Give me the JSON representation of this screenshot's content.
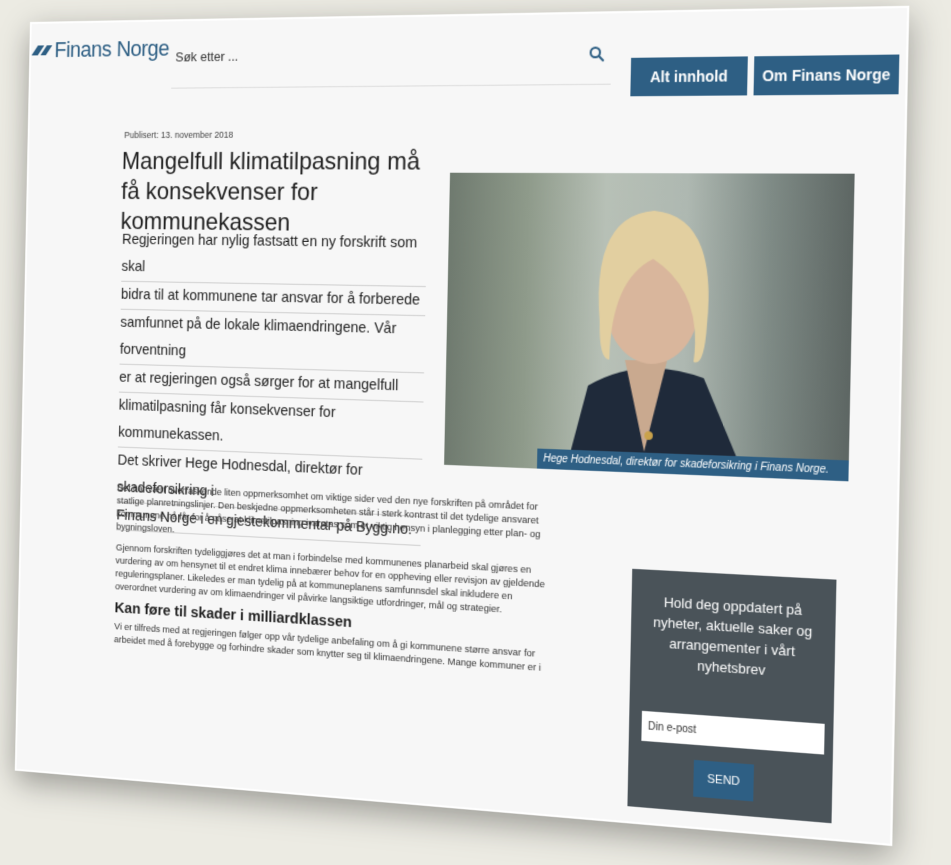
{
  "header": {
    "logo_text": "Finans Norge",
    "search_placeholder": "Søk etter ...",
    "nav": [
      "Alt innhold",
      "Om Finans Norge"
    ]
  },
  "article": {
    "published": "Publisert: 13. november 2018",
    "title": "Mangelfull klimatilpasning må få konsekvenser for kommunekassen",
    "lead_lines": [
      "Regjeringen har nylig fastsatt en ny forskrift som skal",
      "bidra til at kommunene tar ansvar for å forberede",
      "samfunnet på de lokale klimaendringene. Vår forventning",
      "er at regjeringen også sørger for at mangelfull",
      "klimatilpasning får konsekvenser for kommunekassen.",
      "Det skriver Hege Hodnesdal, direktør for skadeforsikring i",
      "Finans Norge i en gjestekommentar på Bygg.no."
    ],
    "photo_caption": "Hege Hodnesdal, direktør for skadeforsikring i Finans Norge.",
    "paragraphs": [
      "Det har vært overraskende liten oppmerksomhet om viktige sider ved den nye forskriften på området for statlige planretningslinjer. Den beskjedne oppmerksomheten står i sterk kontrast til det tydelige ansvaret kommunene nå får for å påse at klimatilpasning ivaretas som et viktig hensyn i planlegging etter plan- og bygningsloven.",
      "Gjennom forskriften tydeliggjøres det at man i forbindelse med kommunenes planarbeid skal gjøres en vurdering av om hensynet til et endret klima innebærer behov for en oppheving eller revisjon av gjeldende reguleringsplaner. Likeledes er man tydelig på at kommuneplanens samfunnsdel skal inkludere en overordnet vurdering av om klimaendringer vil påvirke langsiktige utfordringer, mål og strategier."
    ],
    "subheading": "Kan føre til skader i milliardklassen",
    "paragraph3": "Vi er tilfreds med at regjeringen følger opp vår tydelige anbefaling om å gi kommunene større ansvar for arbeidet med å forebygge og forhindre skader som knytter seg til klimaendringene. Mange kommuner er i"
  },
  "newsletter": {
    "text": "Hold deg oppdatert på nyheter, aktuelle saker og arrangementer i vårt nyhetsbrev",
    "email_placeholder": "Din e-post",
    "send_label": "SEND"
  },
  "colors": {
    "brand": "#2e5f84",
    "newsletter_bg": "#4a5359",
    "background": "#ecebe3"
  },
  "icons": {
    "search": "search-icon"
  }
}
